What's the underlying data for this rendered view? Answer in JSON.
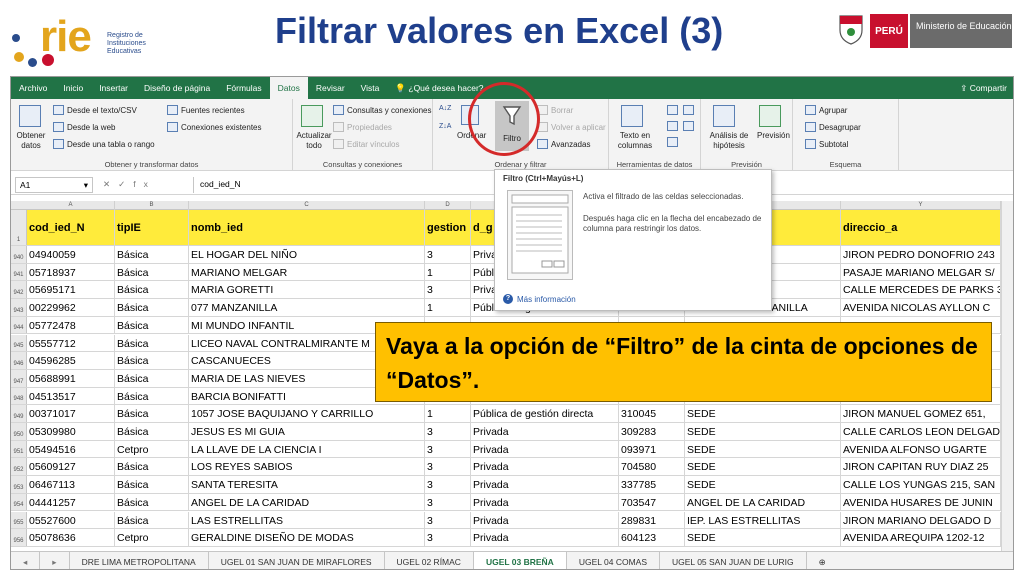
{
  "header": {
    "logo_text": "rie",
    "logo_subtitle_lines": [
      "Registro de",
      "Instituciones",
      "Educativas"
    ],
    "title": "Filtrar valores en Excel (3)",
    "peru_label": "PERÚ",
    "ministry_label": "Ministerio de Educación"
  },
  "menu": {
    "tabs": [
      "Archivo",
      "Inicio",
      "Insertar",
      "Diseño de página",
      "Fórmulas",
      "Datos",
      "Revisar",
      "Vista",
      "¿Qué desea hacer?"
    ],
    "active": "Datos",
    "share": "Compartir"
  },
  "ribbon": {
    "obtener_datos": "Obtener datos",
    "desde_texto": "Desde el texto/CSV",
    "desde_web": "Desde la web",
    "desde_tabla": "Desde una tabla o rango",
    "fuentes_recientes": "Fuentes recientes",
    "conexiones_existentes": "Conexiones existentes",
    "group1_label": "Obtener y transformar datos",
    "actualizar": "Actualizar todo",
    "consultas_conexiones": "Consultas y conexiones",
    "propiedades": "Propiedades",
    "editar_vinculos": "Editar vínculos",
    "group2_label": "Consultas y conexiones",
    "ordenar": "Ordenar",
    "filtro": "Filtro",
    "borrar": "Borrar",
    "volver_aplicar": "Volver a aplicar",
    "avanzadas": "Avanzadas",
    "group3_label": "Ordenar y filtrar",
    "texto_columnas": "Texto en columnas",
    "group4_label": "Herramientas de datos",
    "analisis_hipotesis": "Análisis de hipótesis",
    "prevision": "Previsión",
    "group5_label": "Previsión",
    "agrupar": "Agrupar",
    "desagrupar": "Desagrupar",
    "subtotal": "Subtotal",
    "group6_label": "Esquema"
  },
  "formula_bar": {
    "cell_ref": "A1",
    "fx": "fx",
    "content": "cod_ied_N"
  },
  "columns": [
    "A",
    "B",
    "C",
    "D",
    "E",
    "F",
    "G",
    "Y"
  ],
  "table": {
    "header_row_number": "1",
    "headers": [
      "cod_ied_N",
      "tipIE",
      "nomb_ied",
      "gestion",
      "d_g",
      "",
      "",
      "direccio_a"
    ],
    "rows": [
      {
        "n": "940",
        "cells": [
          "04940059",
          "Básica",
          "EL HOGAR DEL NIÑO",
          "3",
          "Priva",
          "",
          "NIÑO",
          "JIRON PEDRO DONOFRIO 243"
        ]
      },
      {
        "n": "941",
        "cells": [
          "05718937",
          "Básica",
          "MARIANO MELGAR",
          "1",
          "Públ",
          "",
          "",
          "PASAJE MARIANO MELGAR S/"
        ]
      },
      {
        "n": "942",
        "cells": [
          "05695171",
          "Básica",
          "MARIA GORETTI",
          "3",
          "Priva",
          "",
          "",
          "CALLE MERCEDES DE PARKS 3"
        ]
      },
      {
        "n": "943",
        "cells": [
          "00229962",
          "Básica",
          "077 MANZANILLA",
          "1",
          "Pública de gestión directa",
          "",
          "IEP N° 077 MANZANILLA",
          "AVENIDA NICOLAS AYLLON C"
        ]
      },
      {
        "n": "944",
        "cells": [
          "05772478",
          "Básica",
          "MI MUNDO INFANTIL",
          "",
          "",
          "",
          "",
          ""
        ]
      },
      {
        "n": "945",
        "cells": [
          "05557712",
          "Básica",
          "LICEO NAVAL CONTRALMIRANTE M",
          "",
          "",
          "",
          "",
          ""
        ]
      },
      {
        "n": "946",
        "cells": [
          "04596285",
          "Básica",
          "CASCANUECES",
          "",
          "",
          "",
          "",
          ""
        ]
      },
      {
        "n": "947",
        "cells": [
          "05688991",
          "Básica",
          "MARIA DE LAS NIEVES",
          "",
          "",
          "",
          "",
          ""
        ]
      },
      {
        "n": "948",
        "cells": [
          "04513517",
          "Básica",
          "BARCIA BONIFATTI",
          "",
          "Privada",
          "",
          "",
          ""
        ]
      },
      {
        "n": "949",
        "cells": [
          "00371017",
          "Básica",
          "1057 JOSE BAQUIJANO Y CARRILLO",
          "1",
          "Pública de gestión directa",
          "310045",
          "SEDE",
          "JIRON MANUEL GOMEZ 651,"
        ]
      },
      {
        "n": "950",
        "cells": [
          "05309980",
          "Básica",
          "JESUS ES MI GUIA",
          "3",
          "Privada",
          "309283",
          "SEDE",
          "CALLE CARLOS LEON DELGAD"
        ]
      },
      {
        "n": "951",
        "cells": [
          "05494516",
          "Cetpro",
          "LA LLAVE DE LA CIENCIA I",
          "3",
          "Privada",
          "093971",
          "SEDE",
          "AVENIDA ALFONSO UGARTE"
        ]
      },
      {
        "n": "952",
        "cells": [
          "05609127",
          "Básica",
          "LOS REYES SABIOS",
          "3",
          "Privada",
          "704580",
          "SEDE",
          "JIRON CAPITAN RUY DIAZ 25"
        ]
      },
      {
        "n": "953",
        "cells": [
          "06467113",
          "Básica",
          "SANTA TERESITA",
          "3",
          "Privada",
          "337785",
          "SEDE",
          "CALLE LOS YUNGAS 215, SAN"
        ]
      },
      {
        "n": "954",
        "cells": [
          "04441257",
          "Básica",
          "ANGEL DE LA CARIDAD",
          "3",
          "Privada",
          "703547",
          "ANGEL DE LA CARIDAD",
          "AVENIDA HUSARES DE JUNIN"
        ]
      },
      {
        "n": "955",
        "cells": [
          "05527600",
          "Básica",
          "LAS ESTRELLITAS",
          "3",
          "Privada",
          "289831",
          "IEP. LAS ESTRELLITAS",
          "JIRON MARIANO DELGADO D"
        ]
      },
      {
        "n": "956",
        "cells": [
          "05078636",
          "Cetpro",
          "GERALDINE DISEÑO DE MODAS",
          "3",
          "Privada",
          "604123",
          "SEDE",
          "AVENIDA AREQUIPA 1202-12"
        ]
      }
    ]
  },
  "sheet_tabs": [
    "DRE LIMA METROPOLITANA",
    "UGEL 01 SAN JUAN DE MIRAFLORES",
    "UGEL 02 RÍMAC",
    "UGEL 03 BREÑA",
    "UGEL 04 COMAS",
    "UGEL 05 SAN JUAN DE LURIG"
  ],
  "active_sheet": "UGEL 03 BREÑA",
  "tooltip": {
    "title": "Filtro (Ctrl+Mayús+L)",
    "desc1": "Activa el filtrado de las celdas seleccionadas.",
    "desc2": "Después haga clic en la flecha del encabezado de columna para restringir los datos.",
    "more": "Más información"
  },
  "callout": {
    "text": "Vaya a la opción de “Filtro” de la cinta de opciones de “Datos”."
  },
  "colors": {
    "excel_green": "#217346",
    "header_yellow": "#ffeb3b",
    "callout_orange": "#ffc000",
    "title_blue": "#1f3f8c",
    "highlight_red": "#d42a2a"
  }
}
